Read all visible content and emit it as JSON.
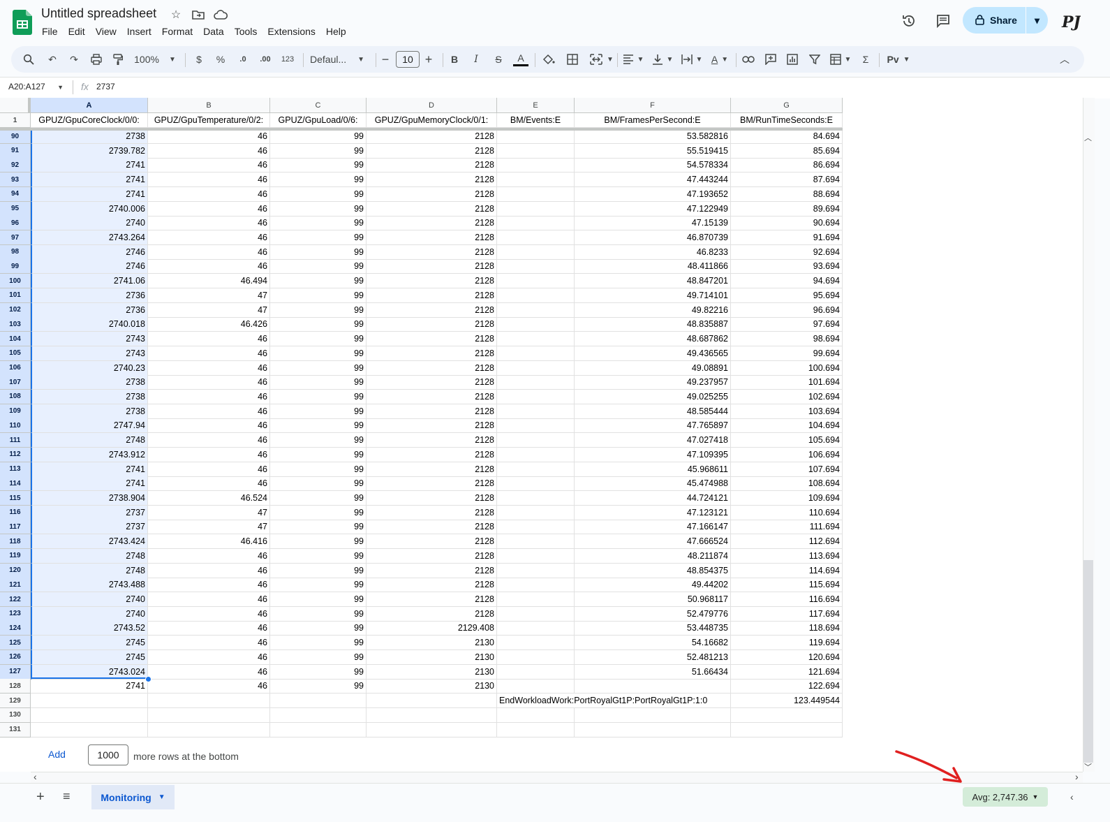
{
  "app": {
    "title": "Untitled spreadsheet",
    "menu": [
      "File",
      "Edit",
      "View",
      "Insert",
      "Format",
      "Data",
      "Tools",
      "Extensions",
      "Help"
    ],
    "share_label": "Share",
    "avatar_initials": "PJ"
  },
  "toolbar": {
    "zoom": "100%",
    "currency": "$",
    "percent": "%",
    "dec_decrease": ".0",
    "dec_increase": ".00",
    "number_format": "123",
    "font": "Defaul...",
    "font_size": "10",
    "bold": "B",
    "italic": "I",
    "strike": "S",
    "text_color": "A",
    "rotate": "A",
    "sigma": "Σ"
  },
  "formula_bar": {
    "name_box": "A20:A127",
    "fx": "fx",
    "value": "2737"
  },
  "columns": [
    "A",
    "B",
    "C",
    "D",
    "E",
    "F",
    "G"
  ],
  "header_row": {
    "num": "1",
    "cells": [
      "GPUZ/GpuCoreClock/0/0:",
      "GPUZ/GpuTemperature/0/2:",
      "GPUZ/GpuLoad/0/6:",
      "GPUZ/GpuMemoryClock/0/1:",
      "BM/Events:E",
      "BM/FramesPerSecond:E",
      "BM/RunTimeSeconds:E"
    ]
  },
  "rows": [
    {
      "n": "90",
      "a": "2738",
      "b": "46",
      "c": "99",
      "d": "2128",
      "e": "",
      "f": "53.582816",
      "g": "84.694"
    },
    {
      "n": "91",
      "a": "2739.782",
      "b": "46",
      "c": "99",
      "d": "2128",
      "e": "",
      "f": "55.519415",
      "g": "85.694"
    },
    {
      "n": "92",
      "a": "2741",
      "b": "46",
      "c": "99",
      "d": "2128",
      "e": "",
      "f": "54.578334",
      "g": "86.694"
    },
    {
      "n": "93",
      "a": "2741",
      "b": "46",
      "c": "99",
      "d": "2128",
      "e": "",
      "f": "47.443244",
      "g": "87.694"
    },
    {
      "n": "94",
      "a": "2741",
      "b": "46",
      "c": "99",
      "d": "2128",
      "e": "",
      "f": "47.193652",
      "g": "88.694"
    },
    {
      "n": "95",
      "a": "2740.006",
      "b": "46",
      "c": "99",
      "d": "2128",
      "e": "",
      "f": "47.122949",
      "g": "89.694"
    },
    {
      "n": "96",
      "a": "2740",
      "b": "46",
      "c": "99",
      "d": "2128",
      "e": "",
      "f": "47.15139",
      "g": "90.694"
    },
    {
      "n": "97",
      "a": "2743.264",
      "b": "46",
      "c": "99",
      "d": "2128",
      "e": "",
      "f": "46.870739",
      "g": "91.694"
    },
    {
      "n": "98",
      "a": "2746",
      "b": "46",
      "c": "99",
      "d": "2128",
      "e": "",
      "f": "46.8233",
      "g": "92.694"
    },
    {
      "n": "99",
      "a": "2746",
      "b": "46",
      "c": "99",
      "d": "2128",
      "e": "",
      "f": "48.411866",
      "g": "93.694"
    },
    {
      "n": "100",
      "a": "2741.06",
      "b": "46.494",
      "c": "99",
      "d": "2128",
      "e": "",
      "f": "48.847201",
      "g": "94.694"
    },
    {
      "n": "101",
      "a": "2736",
      "b": "47",
      "c": "99",
      "d": "2128",
      "e": "",
      "f": "49.714101",
      "g": "95.694"
    },
    {
      "n": "102",
      "a": "2736",
      "b": "47",
      "c": "99",
      "d": "2128",
      "e": "",
      "f": "49.82216",
      "g": "96.694"
    },
    {
      "n": "103",
      "a": "2740.018",
      "b": "46.426",
      "c": "99",
      "d": "2128",
      "e": "",
      "f": "48.835887",
      "g": "97.694"
    },
    {
      "n": "104",
      "a": "2743",
      "b": "46",
      "c": "99",
      "d": "2128",
      "e": "",
      "f": "48.687862",
      "g": "98.694"
    },
    {
      "n": "105",
      "a": "2743",
      "b": "46",
      "c": "99",
      "d": "2128",
      "e": "",
      "f": "49.436565",
      "g": "99.694"
    },
    {
      "n": "106",
      "a": "2740.23",
      "b": "46",
      "c": "99",
      "d": "2128",
      "e": "",
      "f": "49.08891",
      "g": "100.694"
    },
    {
      "n": "107",
      "a": "2738",
      "b": "46",
      "c": "99",
      "d": "2128",
      "e": "",
      "f": "49.237957",
      "g": "101.694"
    },
    {
      "n": "108",
      "a": "2738",
      "b": "46",
      "c": "99",
      "d": "2128",
      "e": "",
      "f": "49.025255",
      "g": "102.694"
    },
    {
      "n": "109",
      "a": "2738",
      "b": "46",
      "c": "99",
      "d": "2128",
      "e": "",
      "f": "48.585444",
      "g": "103.694"
    },
    {
      "n": "110",
      "a": "2747.94",
      "b": "46",
      "c": "99",
      "d": "2128",
      "e": "",
      "f": "47.765897",
      "g": "104.694"
    },
    {
      "n": "111",
      "a": "2748",
      "b": "46",
      "c": "99",
      "d": "2128",
      "e": "",
      "f": "47.027418",
      "g": "105.694"
    },
    {
      "n": "112",
      "a": "2743.912",
      "b": "46",
      "c": "99",
      "d": "2128",
      "e": "",
      "f": "47.109395",
      "g": "106.694"
    },
    {
      "n": "113",
      "a": "2741",
      "b": "46",
      "c": "99",
      "d": "2128",
      "e": "",
      "f": "45.968611",
      "g": "107.694"
    },
    {
      "n": "114",
      "a": "2741",
      "b": "46",
      "c": "99",
      "d": "2128",
      "e": "",
      "f": "45.474988",
      "g": "108.694"
    },
    {
      "n": "115",
      "a": "2738.904",
      "b": "46.524",
      "c": "99",
      "d": "2128",
      "e": "",
      "f": "44.724121",
      "g": "109.694"
    },
    {
      "n": "116",
      "a": "2737",
      "b": "47",
      "c": "99",
      "d": "2128",
      "e": "",
      "f": "47.123121",
      "g": "110.694"
    },
    {
      "n": "117",
      "a": "2737",
      "b": "47",
      "c": "99",
      "d": "2128",
      "e": "",
      "f": "47.166147",
      "g": "111.694"
    },
    {
      "n": "118",
      "a": "2743.424",
      "b": "46.416",
      "c": "99",
      "d": "2128",
      "e": "",
      "f": "47.666524",
      "g": "112.694"
    },
    {
      "n": "119",
      "a": "2748",
      "b": "46",
      "c": "99",
      "d": "2128",
      "e": "",
      "f": "48.211874",
      "g": "113.694"
    },
    {
      "n": "120",
      "a": "2748",
      "b": "46",
      "c": "99",
      "d": "2128",
      "e": "",
      "f": "48.854375",
      "g": "114.694"
    },
    {
      "n": "121",
      "a": "2743.488",
      "b": "46",
      "c": "99",
      "d": "2128",
      "e": "",
      "f": "49.44202",
      "g": "115.694"
    },
    {
      "n": "122",
      "a": "2740",
      "b": "46",
      "c": "99",
      "d": "2128",
      "e": "",
      "f": "50.968117",
      "g": "116.694"
    },
    {
      "n": "123",
      "a": "2740",
      "b": "46",
      "c": "99",
      "d": "2128",
      "e": "",
      "f": "52.479776",
      "g": "117.694"
    },
    {
      "n": "124",
      "a": "2743.52",
      "b": "46",
      "c": "99",
      "d": "2129.408",
      "e": "",
      "f": "53.448735",
      "g": "118.694"
    },
    {
      "n": "125",
      "a": "2745",
      "b": "46",
      "c": "99",
      "d": "2130",
      "e": "",
      "f": "54.16682",
      "g": "119.694"
    },
    {
      "n": "126",
      "a": "2745",
      "b": "46",
      "c": "99",
      "d": "2130",
      "e": "",
      "f": "52.481213",
      "g": "120.694"
    },
    {
      "n": "127",
      "a": "2743.024",
      "b": "46",
      "c": "99",
      "d": "2130",
      "e": "",
      "f": "51.66434",
      "g": "121.694"
    },
    {
      "n": "128",
      "a": "2741",
      "b": "46",
      "c": "99",
      "d": "2130",
      "e": "",
      "f": "",
      "g": "122.694"
    },
    {
      "n": "129",
      "a": "",
      "b": "",
      "c": "",
      "d": "",
      "e": "EndWorkloadWork:PortRoyalGt1P:PortRoyalGt1P:1:0",
      "f": "",
      "g": "123.449544"
    },
    {
      "n": "130",
      "a": "",
      "b": "",
      "c": "",
      "d": "",
      "e": "",
      "f": "",
      "g": ""
    },
    {
      "n": "131",
      "a": "",
      "b": "",
      "c": "",
      "d": "",
      "e": "",
      "f": "",
      "g": ""
    }
  ],
  "add_rows": {
    "button": "Add",
    "count": "1000",
    "label": "more rows at the bottom"
  },
  "sheets": {
    "active_tab": "Monitoring"
  },
  "status": {
    "summary": "Avg: 2,747.36"
  },
  "colors": {
    "share_bg": "#c2e7ff",
    "selection": "#e8f0fe",
    "accent": "#1a73e8",
    "avg_badge": "#d4ecd9",
    "annotation_arrow": "#e02020"
  }
}
